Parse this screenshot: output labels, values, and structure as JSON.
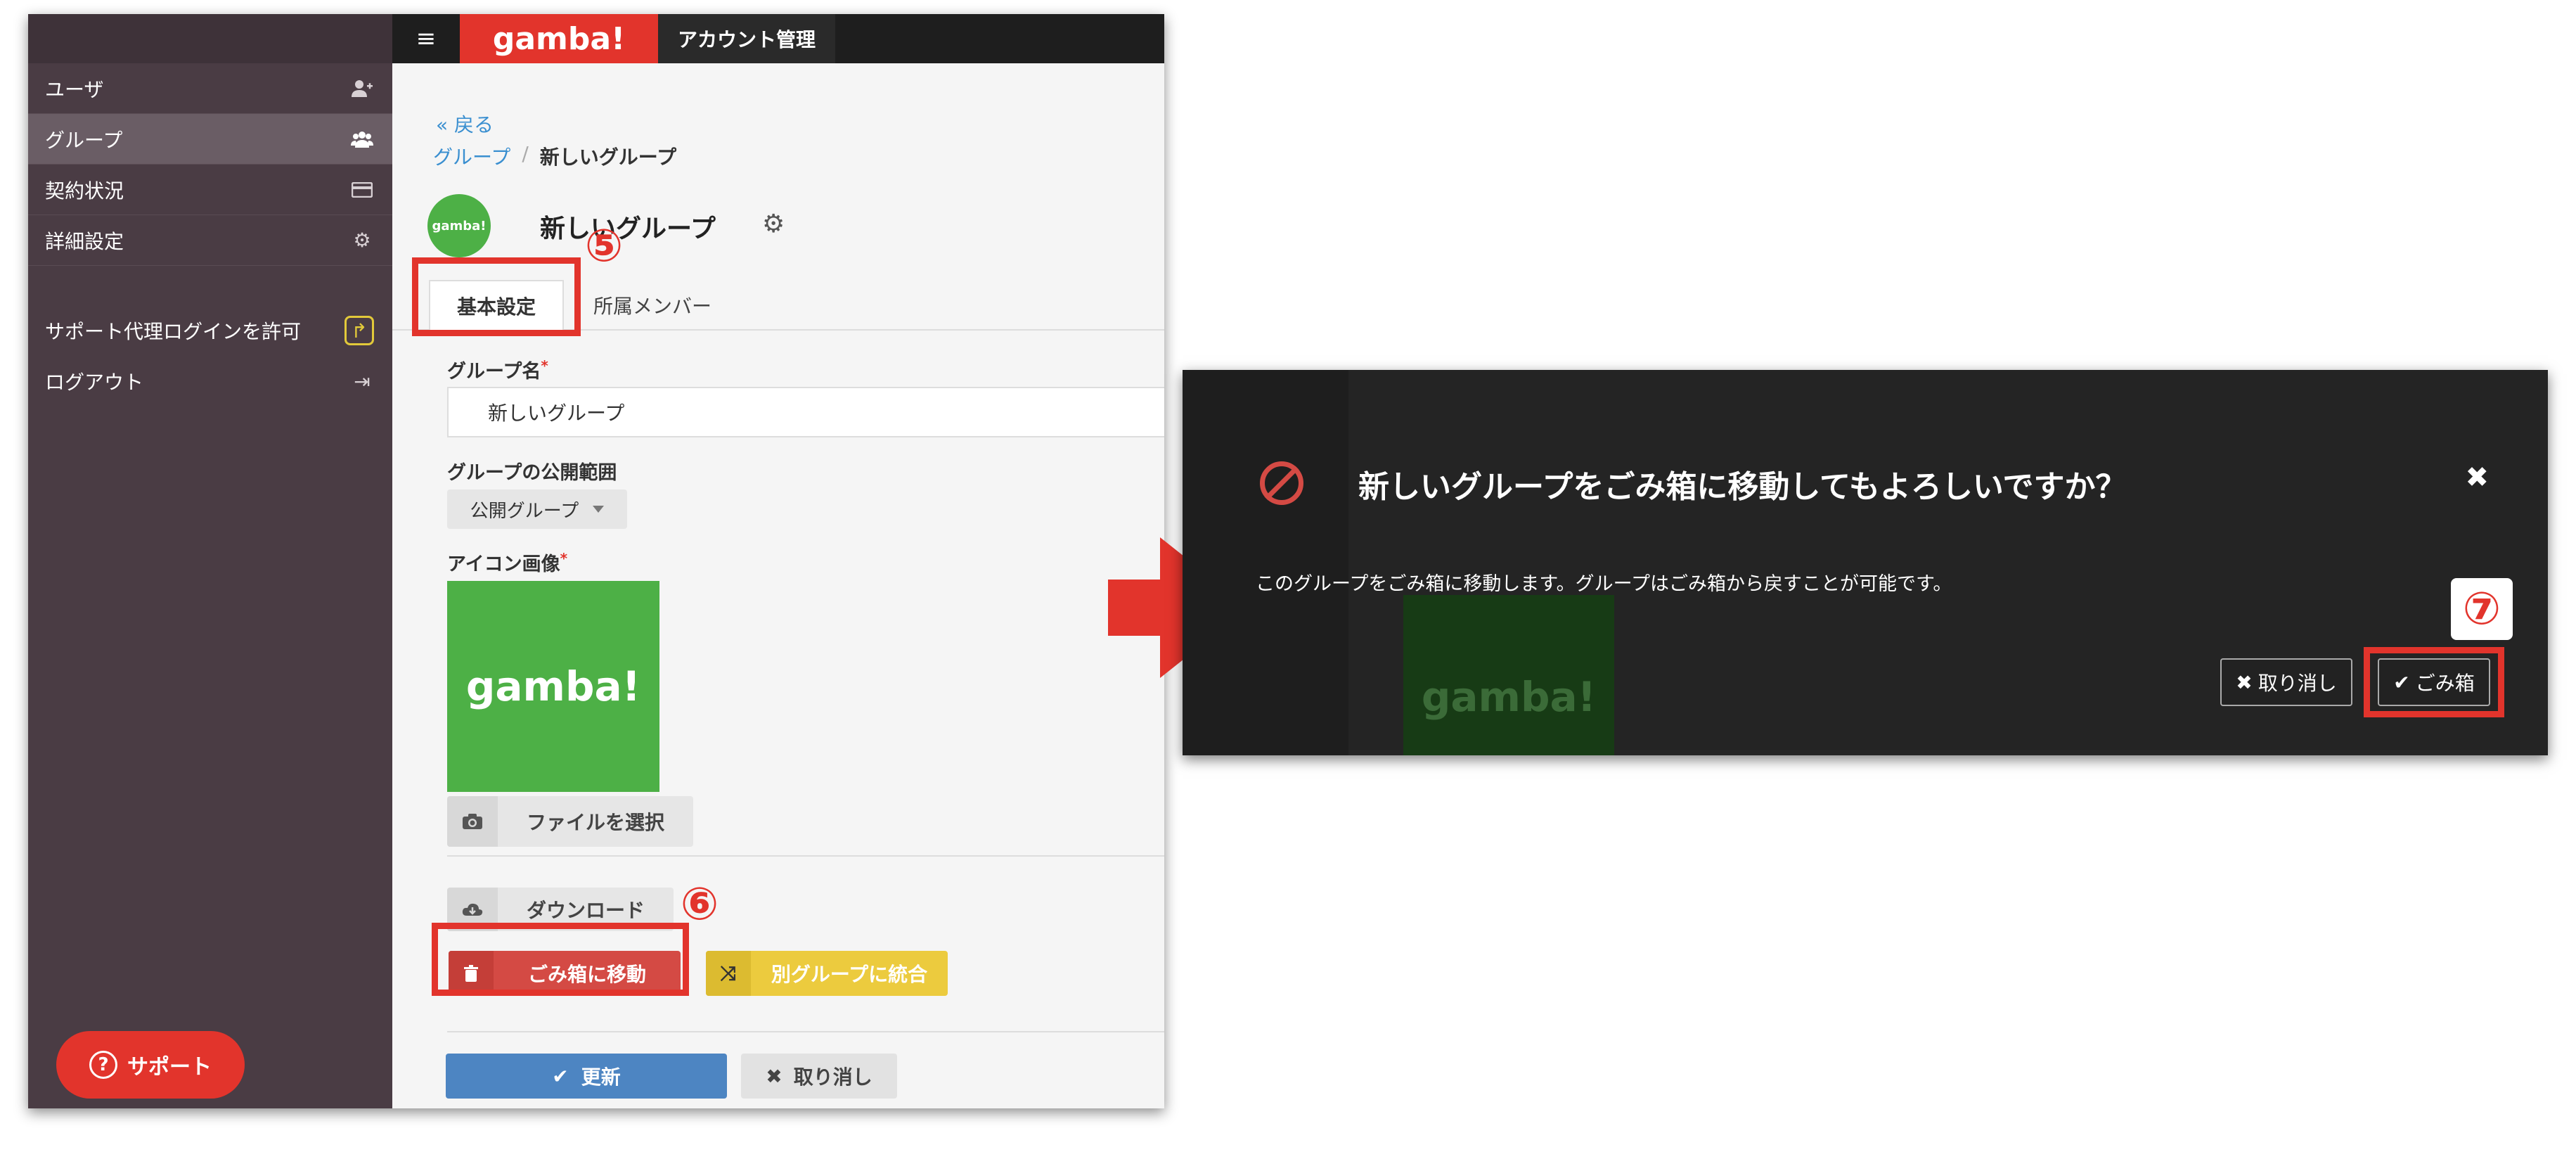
{
  "sidebar": {
    "items": [
      {
        "label": "ユーザ",
        "icon": "add-user-icon"
      },
      {
        "label": "グループ",
        "icon": "group-icon"
      },
      {
        "label": "契約状況",
        "icon": "credit-card-icon"
      },
      {
        "label": "詳細設定",
        "icon": "gears-icon"
      }
    ],
    "proxy_login": "サポート代理ログインを許可",
    "logout": "ログアウト",
    "support": "サポート"
  },
  "header": {
    "logo": "gamba!",
    "account": "アカウント管理"
  },
  "page": {
    "back": "« 戻る",
    "breadcrumb_parent": "グループ",
    "breadcrumb_sep": "/",
    "breadcrumb_current": "新しいグループ",
    "group_icon_text": "gamba!",
    "title": "新しいグループ"
  },
  "tabs": {
    "basic": "基本設定",
    "members": "所属メンバー"
  },
  "form": {
    "group_name_label": "グループ名",
    "group_name_value": "新しいグループ",
    "visibility_label": "グループの公開範囲",
    "visibility_value": "公開グループ",
    "icon_label": "アイコン画像",
    "icon_preview_text": "gamba!",
    "required_mark": "*",
    "file_select": "ファイルを選択",
    "download": "ダウンロード",
    "move_to_trash": "ごみ箱に移動",
    "merge": "別グループに統合",
    "update": "更新",
    "cancel": "取り消し"
  },
  "annotations": {
    "n5": "⑤",
    "n6": "⑥",
    "n7": "⑦"
  },
  "dialog": {
    "title": "新しいグループをごみ箱に移動してもよろしいですか？",
    "message": "このグループをごみ箱に移動します。グループはごみ箱から戻すことが可能です。",
    "cancel": "取り消し",
    "confirm": "ごみ箱",
    "ghost_img_text": "gamba!"
  },
  "colors": {
    "brand_red": "#e2342c",
    "sidebar_bg": "#4a3c44",
    "gamba_green": "#4db046",
    "update_blue": "#4d85c2",
    "merge_yellow": "#eccb3e"
  }
}
